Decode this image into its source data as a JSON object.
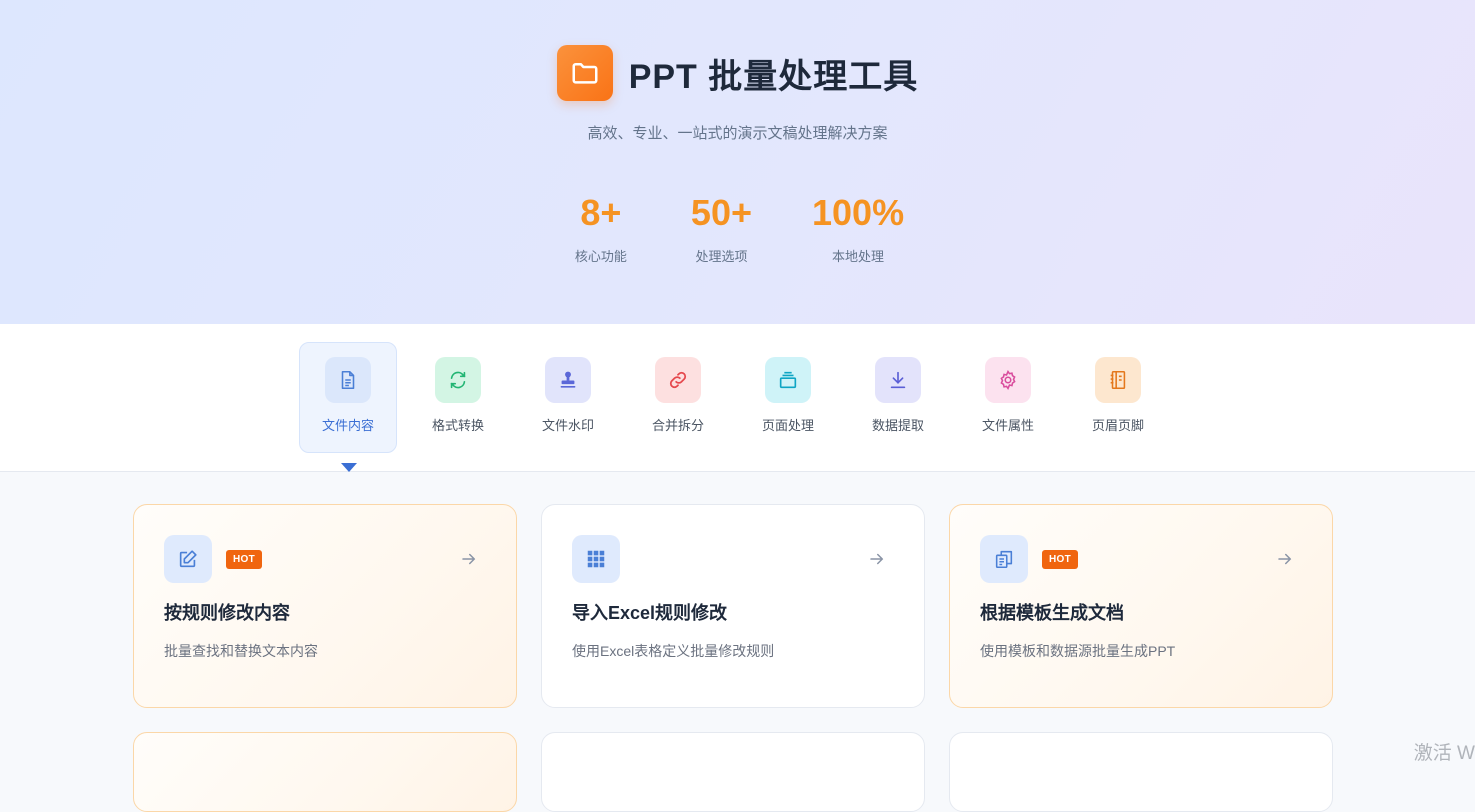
{
  "app": {
    "title": "PPT 批量处理工具",
    "subtitle": "高效、专业、一站式的演示文稿处理解决方案",
    "icon": "folder-icon",
    "accent": "#f97316"
  },
  "stats": [
    {
      "value": "8+",
      "label": "核心功能"
    },
    {
      "value": "50+",
      "label": "处理选项"
    },
    {
      "value": "100%",
      "label": "本地处理"
    }
  ],
  "tabs": [
    {
      "label": "文件内容",
      "icon": "document-icon",
      "active": true
    },
    {
      "label": "格式转换",
      "icon": "refresh-icon"
    },
    {
      "label": "文件水印",
      "icon": "stamp-icon"
    },
    {
      "label": "合并拆分",
      "icon": "link-icon"
    },
    {
      "label": "页面处理",
      "icon": "layers-icon"
    },
    {
      "label": "数据提取",
      "icon": "download-icon"
    },
    {
      "label": "文件属性",
      "icon": "gear-icon"
    },
    {
      "label": "页眉页脚",
      "icon": "notebook-icon"
    }
  ],
  "cards": [
    {
      "title": "按规则修改内容",
      "desc": "批量查找和替换文本内容",
      "badge": "HOT",
      "icon": "edit-icon"
    },
    {
      "title": "导入Excel规则修改",
      "desc": "使用Excel表格定义批量修改规则",
      "badge": "",
      "icon": "grid-icon"
    },
    {
      "title": "根据模板生成文档",
      "desc": "使用模板和数据源批量生成PPT",
      "badge": "HOT",
      "icon": "copy-icon"
    }
  ],
  "watermark": "激活 W"
}
